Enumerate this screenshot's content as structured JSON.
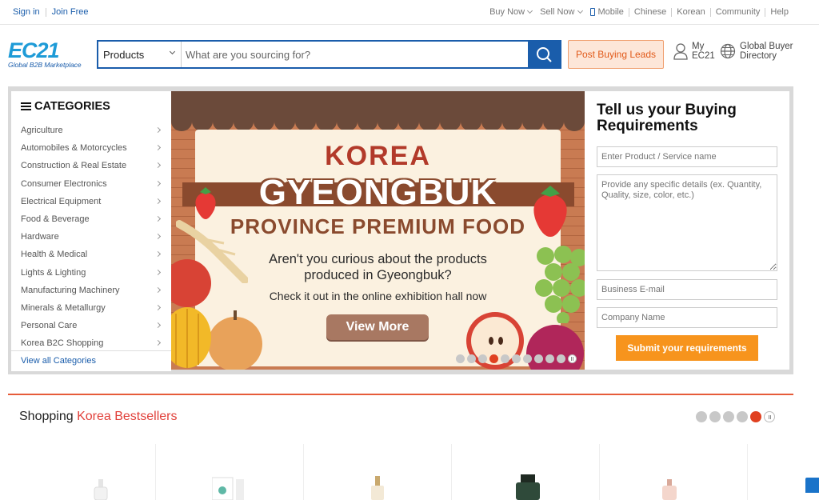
{
  "topbar": {
    "sign_in": "Sign in",
    "join_free": "Join Free",
    "buy_now": "Buy Now",
    "sell_now": "Sell Now",
    "mobile": "Mobile",
    "chinese": "Chinese",
    "korean": "Korean",
    "community": "Community",
    "help": "Help"
  },
  "header": {
    "logo_text": "EC21",
    "logo_tagline": "Global B2B Marketplace",
    "search_category": "Products",
    "search_placeholder": "What are you sourcing for?",
    "post_buying_leads": "Post Buying Leads",
    "my_ec21_line1": "My",
    "my_ec21_line2": "EC21",
    "global_line1": "Global Buyer",
    "global_line2": "Directory"
  },
  "categories": {
    "title": "CATEGORIES",
    "items": [
      "Agriculture",
      "Automobiles & Motorcycles",
      "Construction & Real Estate",
      "Consumer Electronics",
      "Electrical Equipment",
      "Food & Beverage",
      "Hardware",
      "Health & Medical",
      "Lights & Lighting",
      "Manufacturing Machinery",
      "Minerals & Metallurgy",
      "Personal Care",
      "Korea B2C Shopping"
    ],
    "view_all": "View all Categories"
  },
  "banner": {
    "korea": "KOREA",
    "gyeongbuk": "GYEONGBUK",
    "province": "PROVINCE PREMIUM FOOD",
    "question_line1": "Aren't you curious about the products",
    "question_line2": "produced in Gyeongbuk?",
    "check": "Check it out in the online exhibition hall now",
    "view_more": "View More",
    "slide_count": 10,
    "active_slide": 4
  },
  "buying": {
    "title_line1": "Tell us your Buying",
    "title_line2": "Requirements",
    "product_placeholder": "Enter Product / Service name",
    "details_placeholder": "Provide any specific details (ex. Quantity, Quality, size, color, etc.)",
    "email_placeholder": "Business E-mail",
    "company_placeholder": "Company Name",
    "submit": "Submit your requirements"
  },
  "bestsellers": {
    "prefix": "Shopping",
    "accent": "Korea Bestsellers",
    "slide_count": 5,
    "active_slide": 5
  },
  "colors": {
    "brand_blue": "#1a5dab",
    "accent_orange": "#f7941d",
    "accent_red": "#e1403a"
  }
}
